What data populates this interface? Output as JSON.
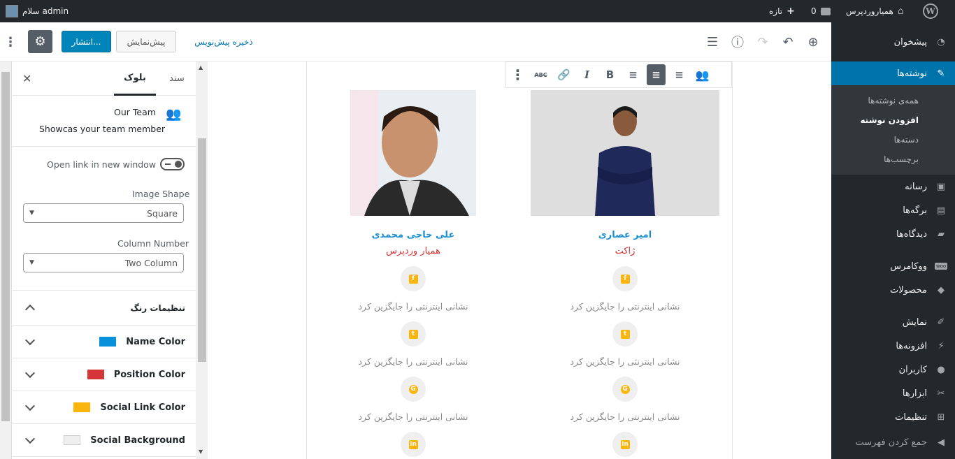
{
  "adminbar": {
    "greeting": "سلام admin",
    "site": "همیاروردپرس",
    "comments": "0",
    "new": "تازه"
  },
  "sidebar": {
    "dashboard": "پیشخوان",
    "posts": "نوشته‌ها",
    "sub_all": "همه‌ی نوشته‌ها",
    "sub_add": "افزودن نوشته",
    "sub_cat": "دسته‌ها",
    "sub_tags": "برچسب‌ها",
    "media": "رسانه",
    "pages": "برگه‌ها",
    "comments": "دیدگاه‌ها",
    "woo": "ووکامرس",
    "products": "محصولات",
    "appearance": "نمایش",
    "plugins": "افزونه‌ها",
    "users": "کاربران",
    "tools": "ابزارها",
    "settings": "تنظیمات",
    "collapse": "جمع کردن فهرست",
    "accent": "#0073aa"
  },
  "toolbar": {
    "publish": "انتشار...",
    "preview": "پیش‌نمایش",
    "save_draft": "ذخیره پیش‌نویس"
  },
  "panel": {
    "tab_block": "بلوک",
    "tab_doc": "سند",
    "block_title": "Our Team",
    "block_desc": "Showcas your team member",
    "open_link": "Open link in new window",
    "image_shape_label": "Image Shape",
    "image_shape_value": "Square",
    "column_label": "Column Number",
    "column_value": "Two Column",
    "color_settings": "تنظیمات رنگ",
    "name_color": "Name Color",
    "position_color": "Position Color",
    "social_link_color": "Social Link Color",
    "social_bg": "Social Background"
  },
  "colors": {
    "name": "#0a91db",
    "position": "#d63638",
    "social": "#fbb60e",
    "social_bg": "#efefef"
  },
  "members": [
    {
      "name": "امیر عصاری",
      "position": "ژاکت",
      "social_text": "نشانی اینترنتی را جایگزین کرد"
    },
    {
      "name": "علی حاجی محمدی",
      "position": "همیار وردپرس",
      "social_text": "نشانی اینترنتی را جایگزین کرد"
    }
  ]
}
